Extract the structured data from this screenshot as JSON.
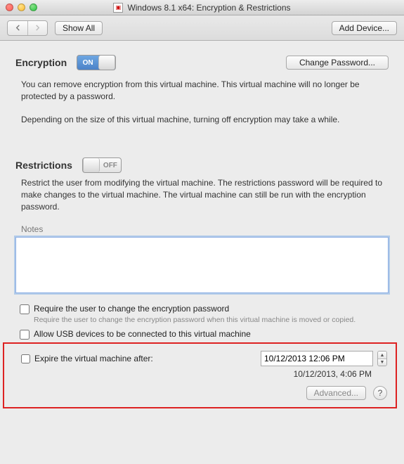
{
  "window": {
    "title": "Windows 8.1 x64: Encryption & Restrictions"
  },
  "toolbar": {
    "show_all": "Show All",
    "add_device": "Add Device..."
  },
  "encryption": {
    "title": "Encryption",
    "toggle_state": "ON",
    "change_password": "Change Password...",
    "desc1": "You can remove encryption from this virtual machine. This virtual machine will no longer be protected by a password.",
    "desc2": "Depending on the size of this virtual machine, turning off encryption may take a while."
  },
  "restrictions": {
    "title": "Restrictions",
    "toggle_state": "OFF",
    "desc": "Restrict the user from modifying the virtual machine. The restrictions password will be required to make changes to the virtual machine. The virtual machine can still be run with the encryption password.",
    "notes_label": "Notes",
    "notes_value": "",
    "chk_require_pw": "Require the user to change the encryption password",
    "chk_require_pw_sub": "Require the user to change the encryption password when this virtual machine is moved or copied.",
    "chk_usb": "Allow USB devices to be connected to this virtual machine",
    "chk_expire": "Expire the virtual machine after:",
    "expire_input": "10/12/2013 12:06 PM",
    "expire_display": "10/12/2013, 4:06 PM",
    "advanced": "Advanced..."
  }
}
